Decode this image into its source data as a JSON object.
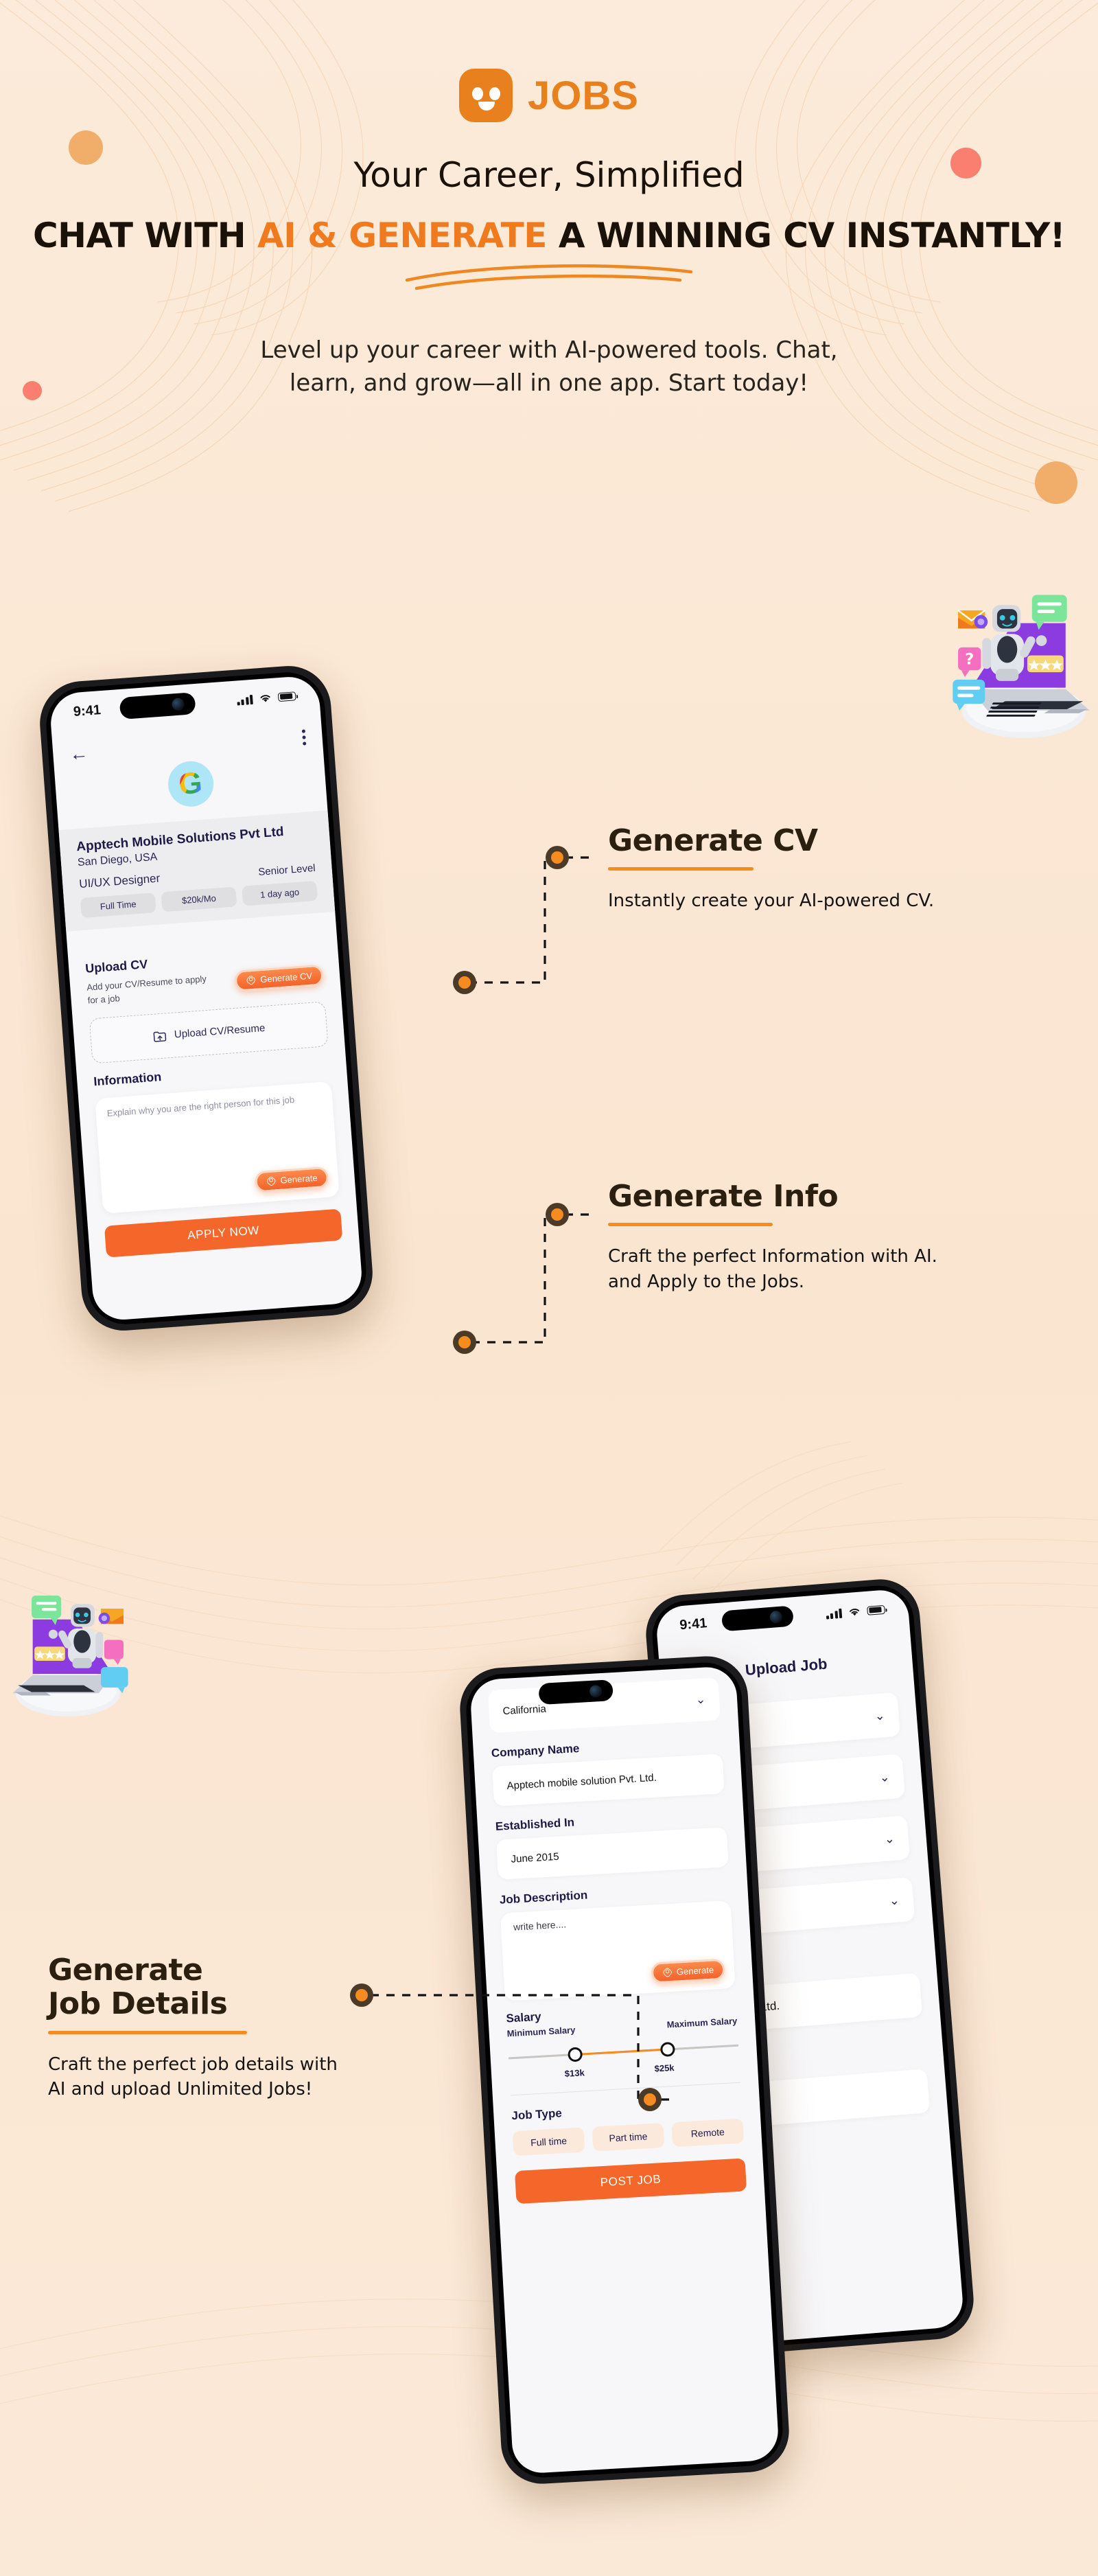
{
  "brand": {
    "logo_text": "JOBS",
    "logo_icon": "smiley-face-icon",
    "accent_orange": "#E8801E",
    "button_orange": "#F4662A",
    "rule_orange": "#F68B1F",
    "bg_cream": "#FBE8D5",
    "dark_navy": "#1D1947"
  },
  "hero": {
    "tagline": "Your Career, Simplified",
    "headline_pre": "CHAT WITH ",
    "headline_accent": "AI & GENERATE",
    "headline_post": " A WINNING CV INSTANTLY!",
    "subcopy_line1": "Level up your career with AI-powered tools. Chat,",
    "subcopy_line2": "learn, and grow—all in one app. Start today!"
  },
  "decor": {
    "circle_tan": "#F0AE6A",
    "circle_salmon": "#FA7F71"
  },
  "phone1": {
    "status_time": "9:41",
    "back_icon": "back-arrow-icon",
    "menu_icon": "kebab-menu-icon",
    "company_logo": "google-g-icon",
    "company_name": "Apptech Mobile Solutions Pvt Ltd",
    "company_location": "San Diego, USA",
    "role": "UI/UX Designer",
    "level": "Senior Level",
    "chips": [
      "Full Time",
      "$20k/Mo",
      "1 day ago"
    ],
    "upload_title": "Upload CV",
    "upload_hint": "Add your CV/Resume to apply for a job",
    "generate_cv_label": "Generate CV",
    "dropzone_label": "Upload CV/Resume",
    "dropzone_icon": "upload-file-icon",
    "information_title": "Information",
    "information_placeholder": "Explain why you are the right person for this job",
    "generate_label": "Generate",
    "apply_label": "APPLY NOW"
  },
  "phone2": {
    "state_value": "California",
    "company_name_label": "Company Name",
    "company_name_value": "Apptech mobile solution Pvt. Ltd.",
    "established_label": "Established In",
    "established_value": "June 2015",
    "job_description_label": "Job Description",
    "job_description_placeholder": "write here....",
    "generate_label": "Generate",
    "salary_label": "Salary",
    "min_salary_label": "Minimum Salary",
    "max_salary_label": "Maximum Salary",
    "min_salary_value": "$13k",
    "max_salary_value": "$25k",
    "job_type_label": "Job Type",
    "job_types": [
      "Full time",
      "Part time",
      "Remote"
    ],
    "post_label": "POST JOB"
  },
  "phone3": {
    "status_time": "9:41",
    "title": "Upload Job",
    "field_value": "ion Pvt. Ltd."
  },
  "callouts": [
    {
      "title": "Generate CV",
      "desc": "Instantly create your AI-powered CV."
    },
    {
      "title": "Generate Info",
      "desc": "Craft the perfect Information with AI.\nand Apply to the Jobs."
    },
    {
      "title": "Generate\nJob Details",
      "desc": "Craft the perfect job details with\nAI and upload Unlimited Jobs!"
    }
  ]
}
